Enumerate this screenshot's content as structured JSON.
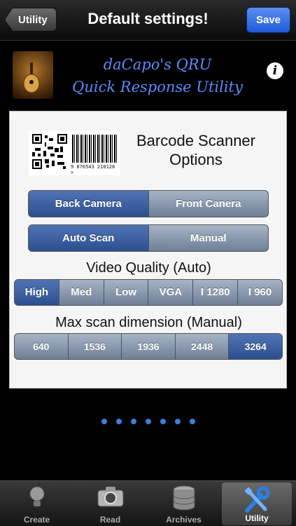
{
  "navbar": {
    "back_label": "Utility",
    "title": "Default settings!",
    "save_label": "Save"
  },
  "header": {
    "app_name_line1": "daCapo's QRU",
    "app_name_line2": "Quick Response Utility",
    "info_glyph": "i"
  },
  "panel": {
    "barcode_number": "9 876543 210128 >",
    "options_title_line1": "Barcode Scanner",
    "options_title_line2": "Options",
    "camera": {
      "options": [
        "Back Camera",
        "Front Canera"
      ],
      "selected": 0
    },
    "scan_mode": {
      "options": [
        "Auto Scan",
        "Manual"
      ],
      "selected": 0
    },
    "video_quality": {
      "label": "Video Quality (Auto)",
      "options": [
        "High",
        "Med",
        "Low",
        "VGA",
        "I 1280",
        "I 960"
      ],
      "selected": 0
    },
    "max_scan": {
      "label": "Max scan dimension (Manual)",
      "options": [
        "640",
        "1536",
        "1936",
        "2448",
        "3264"
      ],
      "selected": 4
    }
  },
  "page_dots": {
    "count": 7
  },
  "tabbar": {
    "tabs": [
      {
        "label": "Create",
        "icon": "lightbulb-icon"
      },
      {
        "label": "Read",
        "icon": "camera-icon"
      },
      {
        "label": "Archives",
        "icon": "database-icon"
      },
      {
        "label": "Utility",
        "icon": "tools-icon"
      }
    ],
    "active": 3
  },
  "colors": {
    "accent": "#3c7fd8",
    "save": "#1e5bd8",
    "app_name": "#5a8cff"
  }
}
